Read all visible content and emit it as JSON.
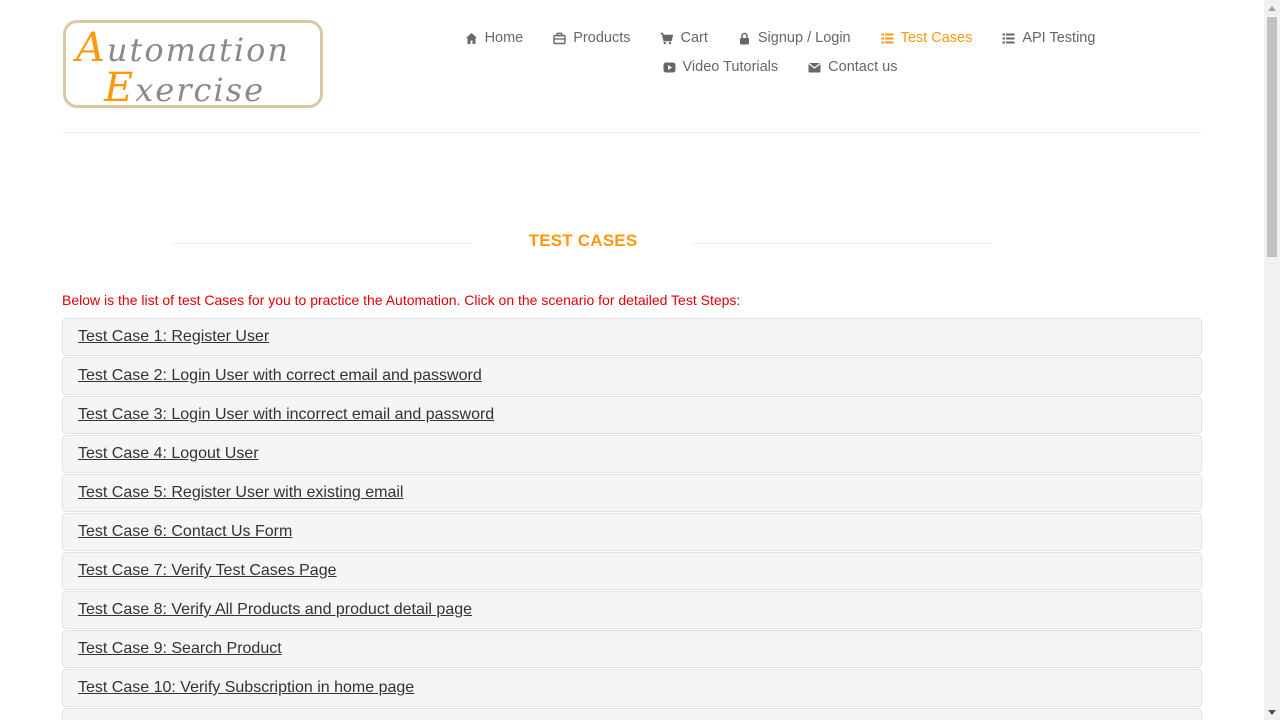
{
  "logo": {
    "line1_cap": "A",
    "line1_rest": "utomation",
    "line2_cap": "E",
    "line2_rest": "xercise"
  },
  "nav": {
    "row1": [
      {
        "label": "Home",
        "icon": "home-icon",
        "active": false
      },
      {
        "label": "Products",
        "icon": "briefcase-icon",
        "active": false
      },
      {
        "label": "Cart",
        "icon": "cart-icon",
        "active": false
      },
      {
        "label": "Signup / Login",
        "icon": "lock-icon",
        "active": false
      },
      {
        "label": "Test Cases",
        "icon": "list-icon",
        "active": true
      },
      {
        "label": "API Testing",
        "icon": "list-icon",
        "active": false
      }
    ],
    "row2": [
      {
        "label": "Video Tutorials",
        "icon": "youtube-play-icon",
        "active": false
      },
      {
        "label": "Contact us",
        "icon": "envelope-icon",
        "active": false
      }
    ]
  },
  "colors": {
    "accent": "#fe980f",
    "intro_text": "#e00000",
    "nav_text": "#696763"
  },
  "section": {
    "title": "TEST CASES",
    "intro": "Below is the list of test Cases for you to practice the Automation. Click on the scenario for detailed Test Steps:"
  },
  "test_cases": [
    "Test Case 1: Register User",
    "Test Case 2: Login User with correct email and password",
    "Test Case 3: Login User with incorrect email and password",
    "Test Case 4: Logout User",
    "Test Case 5: Register User with existing email",
    "Test Case 6: Contact Us Form",
    "Test Case 7: Verify Test Cases Page",
    "Test Case 8: Verify All Products and product detail page",
    "Test Case 9: Search Product",
    "Test Case 10: Verify Subscription in home page",
    ""
  ]
}
